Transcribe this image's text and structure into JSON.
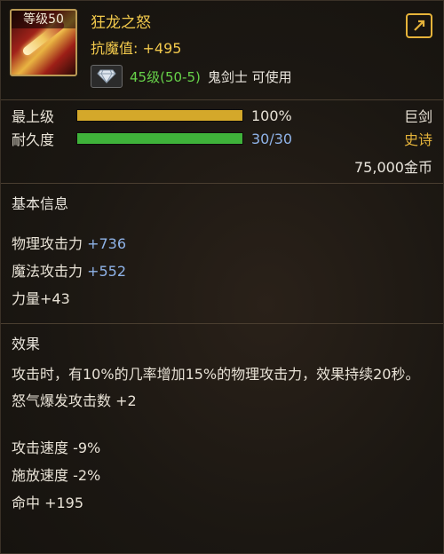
{
  "item": {
    "level_badge": "等级50",
    "name": "狂龙之怒",
    "magic_resist": "抗魔值: +495",
    "requirement_level": "45级(50-5)",
    "requirement_class": "鬼剑士 可使用"
  },
  "bars": [
    {
      "label": "最上级",
      "value_text": "100%",
      "fraction": 1.0,
      "right": "巨剑",
      "color": "#d4a82a"
    },
    {
      "label": "耐久度",
      "value_text": "30/30",
      "fraction": 1.0,
      "right": "史诗",
      "color": "#3fb23a"
    }
  ],
  "price": "75,000金币",
  "basic_info": {
    "title": "基本信息",
    "phys_label": "物理攻击力 ",
    "phys_value": "+736",
    "magic_label": "魔法攻击力 ",
    "magic_value": "+552",
    "strength": "力量+43"
  },
  "effects": {
    "title": "效果",
    "desc": "攻击时，有10%的几率增加15%的物理攻击力，效果持续20秒。",
    "rage": "怒气爆发攻击数 +2",
    "attack_speed": "攻击速度 -9%",
    "cast_speed": "施放速度 -2%",
    "hit": "命中 +195"
  },
  "colors": {
    "gold": "#f2c94c",
    "green": "#67d24a",
    "epic_gold": "#e3b23a",
    "blue": "#8fb3e8"
  },
  "icons": {
    "share": "share-export-icon",
    "gem": "diamond-icon"
  }
}
